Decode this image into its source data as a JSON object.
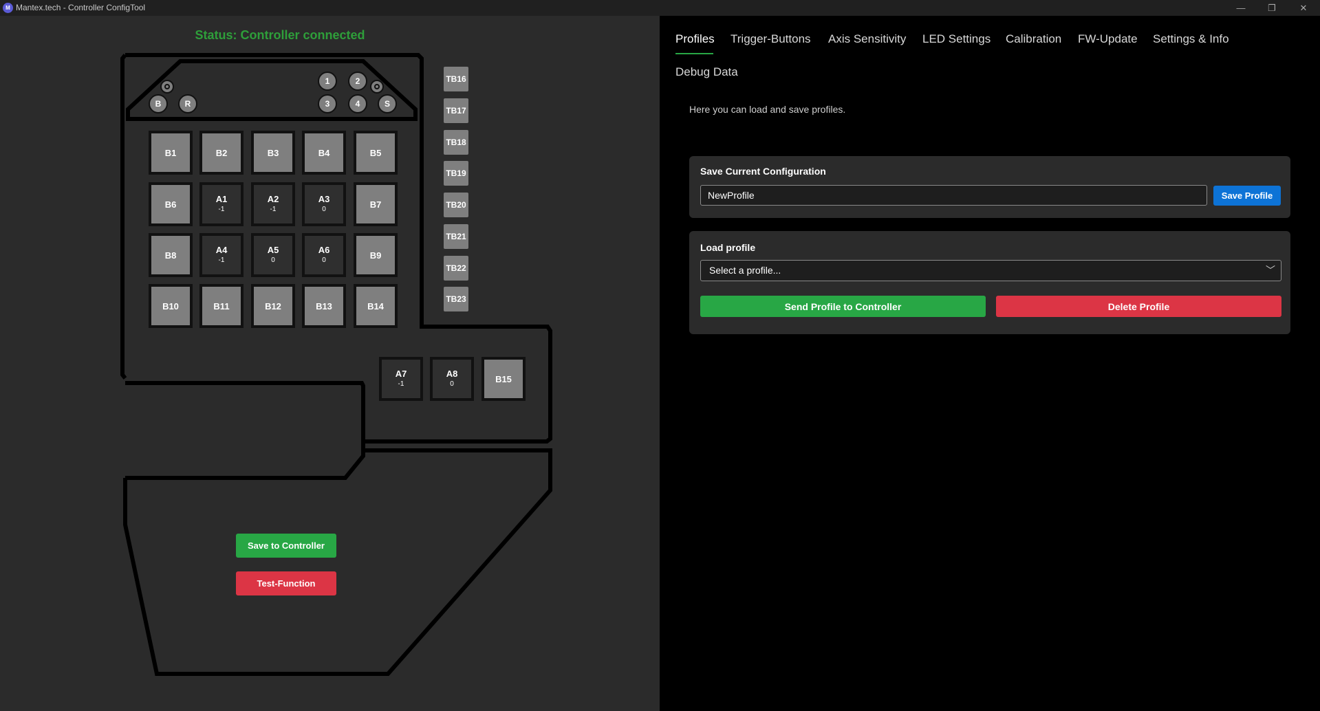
{
  "window": {
    "title": "Mantex.tech - Controller ConfigTool",
    "icon_name": "app-logo-icon",
    "icon_letters": "M",
    "controls": {
      "minimize": "—",
      "maximize": "❐",
      "close": "✕"
    }
  },
  "left": {
    "status": "Status: Controller connected",
    "top_buttons": {
      "b": "B",
      "r": "R",
      "n1": "1",
      "n2": "2",
      "n3": "3",
      "n4": "4",
      "s": "S"
    },
    "thumb_buttons": [
      "TB16",
      "TB17",
      "TB18",
      "TB19",
      "TB20",
      "TB21",
      "TB22",
      "TB23"
    ],
    "grid": [
      [
        {
          "label": "B1"
        },
        {
          "label": "B2"
        },
        {
          "label": "B3"
        },
        {
          "label": "B4"
        },
        {
          "label": "B5"
        }
      ],
      [
        {
          "label": "B6"
        },
        {
          "label": "A1",
          "value": "-1"
        },
        {
          "label": "A2",
          "value": "-1"
        },
        {
          "label": "A3",
          "value": "0"
        },
        {
          "label": "B7"
        }
      ],
      [
        {
          "label": "B8"
        },
        {
          "label": "A4",
          "value": "-1"
        },
        {
          "label": "A5",
          "value": "0"
        },
        {
          "label": "A6",
          "value": "0"
        },
        {
          "label": "B9"
        }
      ],
      [
        {
          "label": "B10"
        },
        {
          "label": "B11"
        },
        {
          "label": "B12"
        },
        {
          "label": "B13"
        },
        {
          "label": "B14"
        }
      ]
    ],
    "extra": [
      {
        "label": "A7",
        "value": "-1"
      },
      {
        "label": "A8",
        "value": "0"
      },
      {
        "label": "B15"
      }
    ],
    "save_controller": "Save to Controller",
    "test_function": "Test-Function"
  },
  "tabs": [
    "Profiles",
    "Trigger-Buttons",
    "Axis Sensitivity",
    "LED Settings",
    "Calibration",
    "FW-Update",
    "Settings & Info",
    "Debug Data"
  ],
  "profiles": {
    "intro": "Here you can load and save profiles.",
    "save_section": {
      "title": "Save Current Configuration",
      "name_value": "NewProfile",
      "save_button": "Save Profile"
    },
    "load_section": {
      "title": "Load profile",
      "select_value": "Select a profile...",
      "send_button": "Send Profile to Controller",
      "delete_button": "Delete Profile"
    }
  },
  "colors": {
    "green": "#28a745",
    "red": "#dc3545",
    "blue": "#0d73d6",
    "status_green": "#2e9f3a"
  }
}
